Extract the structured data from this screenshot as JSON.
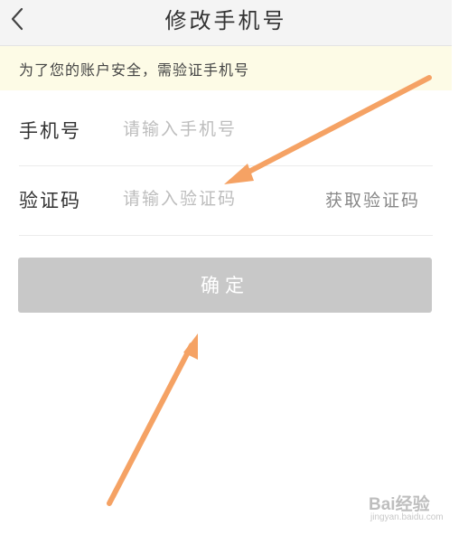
{
  "header": {
    "back_icon": "chevron-left-icon",
    "title": "修改手机号"
  },
  "notice": {
    "text": "为了您的账户安全，需验证手机号"
  },
  "form": {
    "phone": {
      "label": "手机号",
      "value": "",
      "placeholder": "请输入手机号"
    },
    "code": {
      "label": "验证码",
      "value": "",
      "placeholder": "请输入验证码",
      "get_code_label": "获取验证码"
    }
  },
  "confirm_button": {
    "label": "确定"
  },
  "annotations": {
    "arrow_color": "#f5a264",
    "arrows": [
      "arrow-to-code-input",
      "arrow-to-confirm-button"
    ]
  },
  "watermark": {
    "logo": "Bai经验",
    "url": "jingyan.baidu.com"
  },
  "colors": {
    "header_bg": "#f4f4f4",
    "notice_bg": "#fdfbe6",
    "button_disabled": "#c8c8c8",
    "placeholder": "#bdbdbd"
  }
}
